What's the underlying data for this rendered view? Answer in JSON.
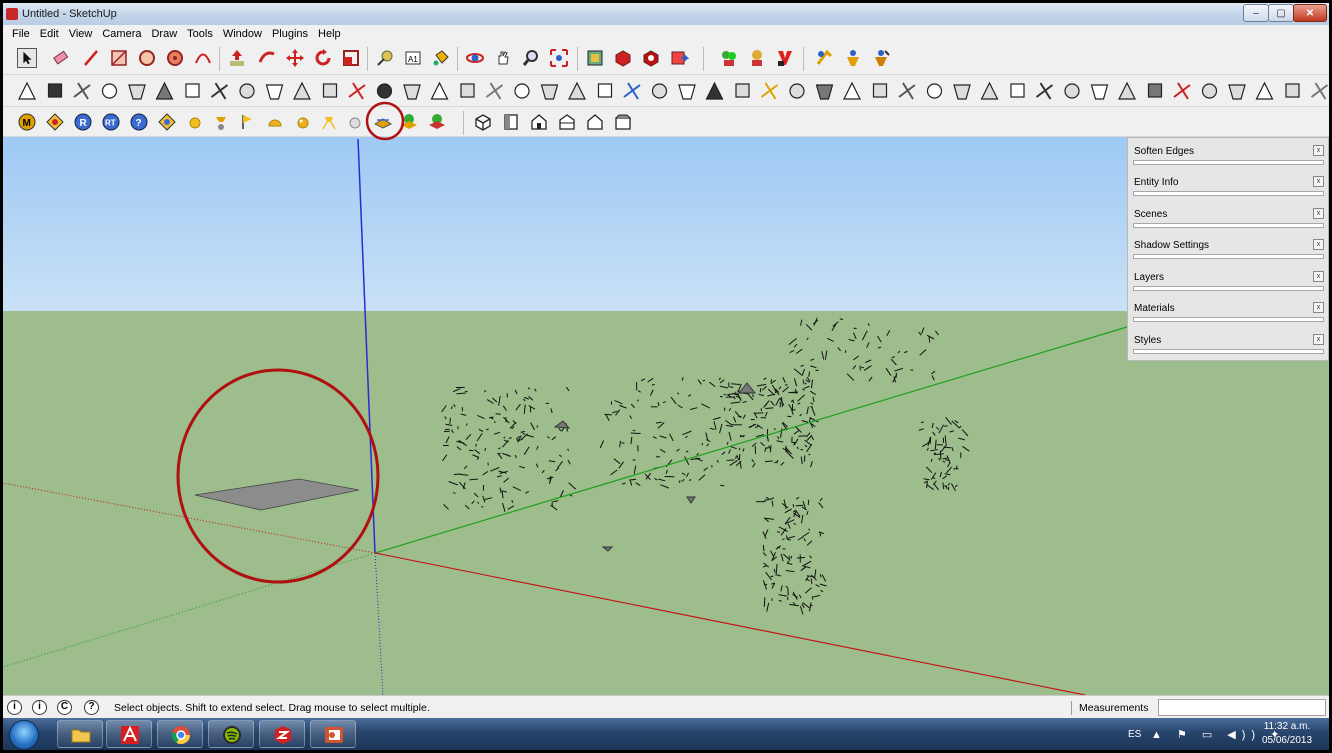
{
  "window": {
    "title": "Untitled - SketchUp",
    "min_glyph": "–",
    "max_glyph": "▢",
    "close_glyph": "✕"
  },
  "menu": [
    "File",
    "Edit",
    "View",
    "Camera",
    "Draw",
    "Tools",
    "Window",
    "Plugins",
    "Help"
  ],
  "tray": {
    "panels": [
      "Soften Edges",
      "Entity Info",
      "Scenes",
      "Shadow Settings",
      "Layers",
      "Materials",
      "Styles"
    ],
    "close_glyph": "x"
  },
  "statusbar": {
    "icons": [
      "i",
      "i",
      "C",
      "?"
    ],
    "message": "Select objects. Shift to extend select. Drag mouse to select multiple.",
    "measurements_label": "Measurements",
    "measurements_value": ""
  },
  "taskbar": {
    "apps": [
      "explorer-icon",
      "autocad-icon",
      "chrome-icon",
      "spotify-icon",
      "sketchup-icon",
      "powerpoint-icon"
    ],
    "language": "ES",
    "tray_icons": "▲ ⚑ ▭ ◀)) ✦",
    "time": "11:32 a.m.",
    "date": "05/06/2013"
  },
  "colors": {
    "ground": "#9dbd8c",
    "sky": "#a8cff4",
    "axis_blue": "#2b2bd0",
    "axis_green": "#1fa01f",
    "axis_red": "#c41818",
    "annotation_circle": "#b01010"
  }
}
